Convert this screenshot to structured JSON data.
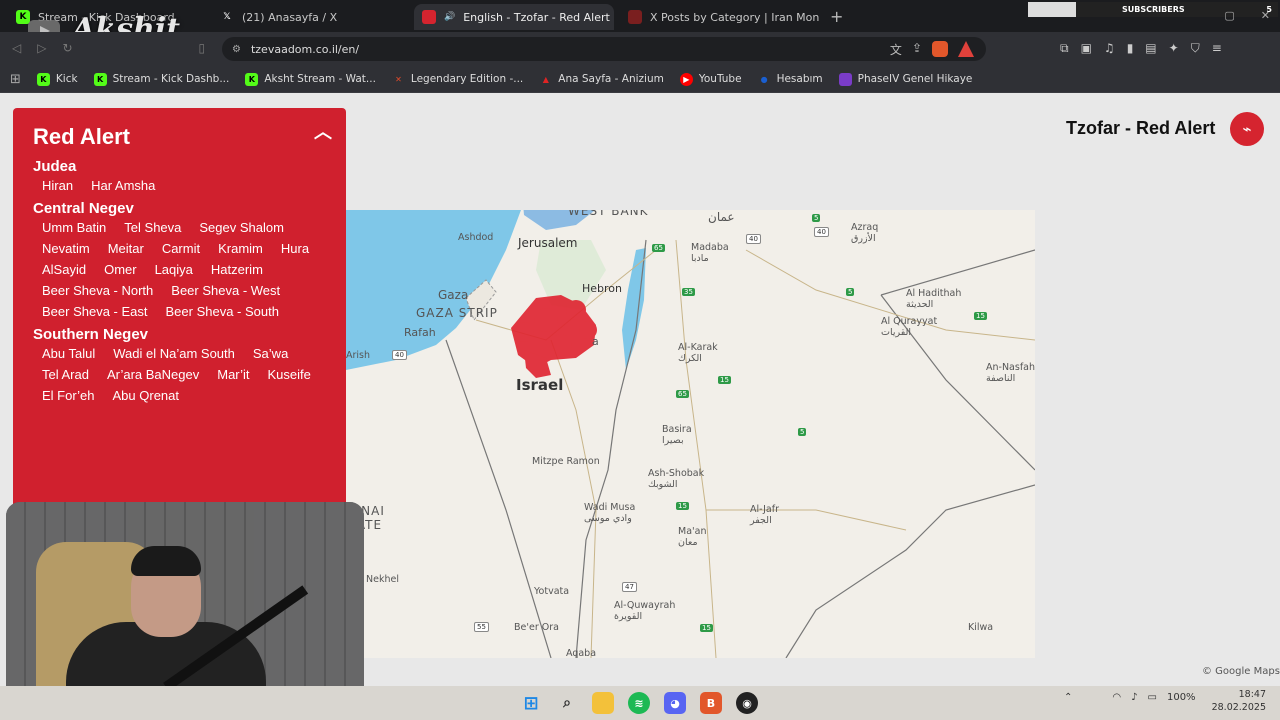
{
  "tabs": [
    {
      "label": "Stream - Kick Dashboard",
      "favicon": "kick-icon",
      "color": "#53fc18"
    },
    {
      "label": "(21) Anasayfa / X",
      "favicon": "x-icon",
      "color": "#000000"
    },
    {
      "label": "English - Tzofar - Red Alert",
      "favicon": "tzofar-icon",
      "color": "#d5242f",
      "active": true
    },
    {
      "label": "X Posts by Category | Iran Monitor",
      "favicon": "iran-monitor-icon",
      "color": "#7a1f1f"
    }
  ],
  "overlay": {
    "channel_name": "Akshit",
    "subscribers_label": "SUBSCRIBERS",
    "subscribers_count": "5"
  },
  "address": {
    "url": "tzevaadom.co.il/en/"
  },
  "bookmarks": [
    {
      "label": "Kick",
      "icon": "kick-icon",
      "color": "#53fc18"
    },
    {
      "label": "Stream - Kick Dashb...",
      "icon": "kick-icon",
      "color": "#53fc18"
    },
    {
      "label": "Aksht Stream - Wat...",
      "icon": "kick-icon",
      "color": "#53fc18"
    },
    {
      "label": "Legendary Edition -...",
      "icon": "game-icon",
      "color": "#e24a2a"
    },
    {
      "label": "Ana Sayfa - Anizium",
      "icon": "anizium-icon",
      "color": "#e02424"
    },
    {
      "label": "YouTube",
      "icon": "youtube-icon",
      "color": "#ff0000"
    },
    {
      "label": "Hesabım",
      "icon": "account-icon",
      "color": "#1a5fd1"
    },
    {
      "label": "PhaseIV Genel Hikaye",
      "icon": "phase-icon",
      "color": "#7a3cc8"
    }
  ],
  "page": {
    "title": "Tzofar - Red Alert",
    "map_credit": "© Google Maps"
  },
  "alert_panel": {
    "title": "Red Alert",
    "regions": [
      {
        "name": "Judea",
        "places": [
          "Hiran",
          "Har Amsha"
        ]
      },
      {
        "name": "Central Negev",
        "places": [
          "Umm Batin",
          "Tel Sheva",
          "Segev Shalom",
          "Nevatim",
          "Meitar",
          "Carmit",
          "Kramim",
          "Hura",
          "AlSayid",
          "Omer",
          "Laqiya",
          "Hatzerim",
          "Beer Sheva - North",
          "Beer Sheva - West",
          "Beer Sheva - East",
          "Beer Sheva - South"
        ]
      },
      {
        "name": "Southern Negev",
        "places": [
          "Abu Talul",
          "Wadi el Na’am South",
          "Sa’wa",
          "Tel Arad",
          "Ar’ara BaNegev",
          "Mar’it",
          "Kuseife",
          "El For’eh",
          "Abu Qrenat"
        ]
      }
    ]
  },
  "map_labels": {
    "ashdod": "Ashdod",
    "jerusalem": "Jerusalem",
    "west_bank": "WEST BANK",
    "amman": "عمان",
    "gaza": "Gaza",
    "gaza_strip": "GAZA STRIP",
    "rafah": "Rafah",
    "hebron": "Hebron",
    "israel": "Israel",
    "madaba": "Madaba\nمادبا",
    "azraq": "Azraq\nالأزرق",
    "al_hadithah": "Al Hadithah\nالحديثة",
    "al_qurayyat": "Al Qurayyat\nالقريات",
    "an_nasfah": "An-Nasfah\nالناصفة",
    "al_karak": "Al-Karak\nالكرك",
    "arad_partial": "a",
    "arish": "Arish",
    "sinai": "SINAI\nRATE",
    "basira": "Basira\nبصيرا",
    "shobak": "Ash-Shobak\nالشوبك",
    "mitzpe_ramon": "Mitzpe Ramon",
    "wadi_musa": "Wadi Musa\nوادي موسى",
    "al_jafr": "Al-Jafr\nالجفر",
    "maan": "Ma'an\nمعان",
    "nekhel": "Nekhel",
    "yotvata": "Yotvata",
    "al_quwayrah": "Al-Quwayrah\nالقويرة",
    "beer_ora": "Be'er Ora",
    "aqaba": "Aqaba",
    "kilwa": "Kilwa"
  },
  "road_shields": [
    "40",
    "40",
    "65",
    "15",
    "35",
    "5",
    "15",
    "5",
    "15",
    "65",
    "5",
    "15",
    "47",
    "55",
    "15",
    "40"
  ],
  "taskbar": {
    "battery": "100%",
    "time": "18:47",
    "date": "28.02.2025"
  }
}
